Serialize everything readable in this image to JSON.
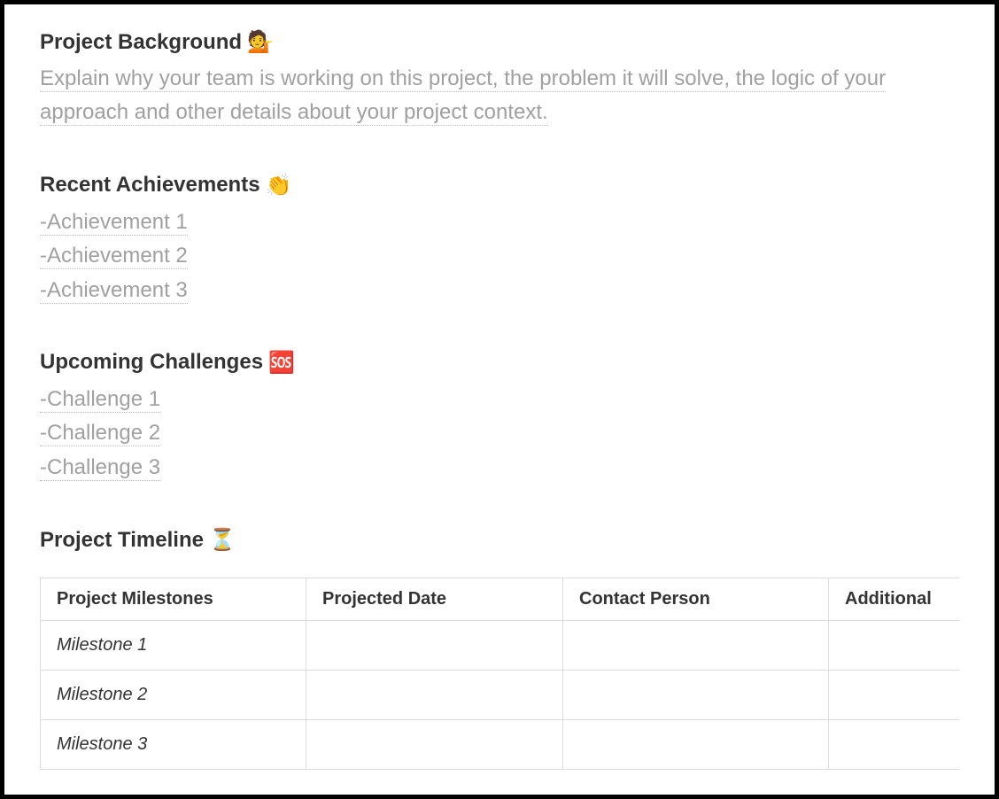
{
  "background": {
    "heading": "Project Background",
    "emoji": "💁",
    "placeholder": "Explain why your team is working on this project, the problem it will solve, the logic of your approach and other details about your project context."
  },
  "achievements": {
    "heading": "Recent Achievements",
    "emoji": "👏",
    "items": [
      "-Achievement 1",
      "-Achievement 2",
      "-Achievement 3"
    ]
  },
  "challenges": {
    "heading": "Upcoming Challenges",
    "emoji": "🆘",
    "items": [
      "-Challenge 1",
      "-Challenge 2",
      "-Challenge 3"
    ]
  },
  "timeline": {
    "heading": "Project Timeline",
    "emoji": "⏳",
    "columns": [
      "Project Milestones",
      "Projected Date",
      "Contact Person",
      "Additional"
    ],
    "rows": [
      {
        "milestone": "Milestone 1",
        "date": "",
        "contact": "",
        "additional": ""
      },
      {
        "milestone": "Milestone 2",
        "date": "",
        "contact": "",
        "additional": ""
      },
      {
        "milestone": "Milestone 3",
        "date": "",
        "contact": "",
        "additional": ""
      }
    ]
  }
}
